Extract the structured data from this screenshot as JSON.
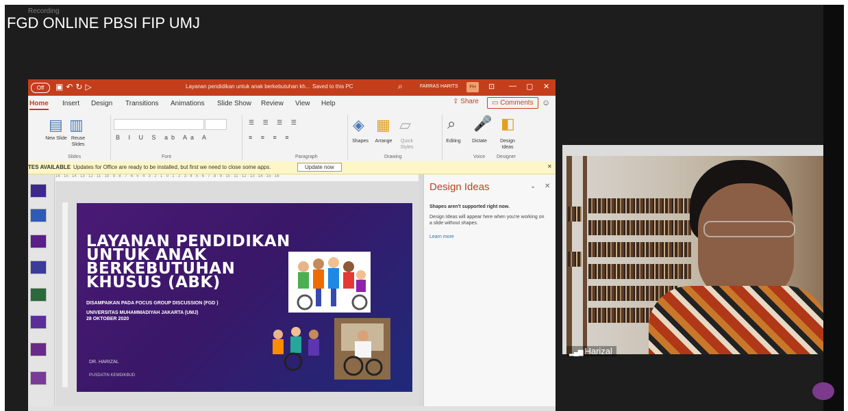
{
  "recording": {
    "label": "Recording"
  },
  "meeting": {
    "title": "FGD ONLINE PBSI FIP UMJ"
  },
  "ppt": {
    "autosave_label": "Off",
    "window_title": "Layanan pendidikan untuk anak berkebutuhan kh...",
    "saved_status": "Saved to this PC",
    "user_name": "FARRAS HARITS",
    "user_initials": "FH",
    "tabs": [
      "Home",
      "Insert",
      "Design",
      "Transitions",
      "Animations",
      "Slide Show",
      "Review",
      "View",
      "Help"
    ],
    "share_label": "Share",
    "comments_label": "Comments",
    "ribbon": {
      "new_slide": "New Slide",
      "reuse_slides": "Reuse Slides",
      "slides_group": "Slides",
      "font_group": "Font",
      "paragraph_group": "Paragraph",
      "shapes": "Shapes",
      "arrange": "Arrange",
      "quick_styles": "Quick Styles",
      "drawing_group": "Drawing",
      "editing": "Editing",
      "dictate": "Dictate",
      "voice_group": "Voice",
      "design_ideas": "Design Ideas",
      "designer_group": "Designer"
    },
    "update_bar": {
      "title": "TES AVAILABLE",
      "message": "Updates for Office are ready to be installed, but first we need to close some apps.",
      "button": "Update now"
    },
    "ruler_text": "16 · 15 · 14 · 13 · 12 · 11 · 10 · 9 · 8 · 7 · 6 · 5 · 4 · 3 · 2 · 1 · 0 · 1 · 2 · 3 · 4 · 5 · 6 · 7 · 8 · 9 · 10 · 11 · 12 · 13 · 14 · 15 · 16",
    "slide": {
      "title": "LAYANAN PENDIDIKAN\nUNTUK ANAK\nBERKEBUTUHAN\nKHUSUS (ABK)",
      "sub1": "DISAMPAIKAN PADA FOCUS GROUP DISCUSSION (FGD )",
      "sub2": "UNIVERSITAS MUHAMMADIYAH JAKARTA (UMJ)",
      "sub3": "28 OKTOBER 2020",
      "presenter": "DR. HARIZAL",
      "org": "PUSDATIN KEMDIKBUD"
    },
    "design_pane": {
      "title": "Design Ideas",
      "heading": "Shapes aren't supported right now.",
      "message": "Design Ideas will appear here when you're working on a slide without shapes.",
      "link": "Learn more"
    }
  },
  "camera": {
    "participant_name": "Harizal"
  },
  "colors": {
    "ppt_accent": "#c43e1c",
    "update_bar": "#fdf6c6",
    "slide_bg": "#3a1768",
    "meeting_bg": "#1d1d1d"
  }
}
